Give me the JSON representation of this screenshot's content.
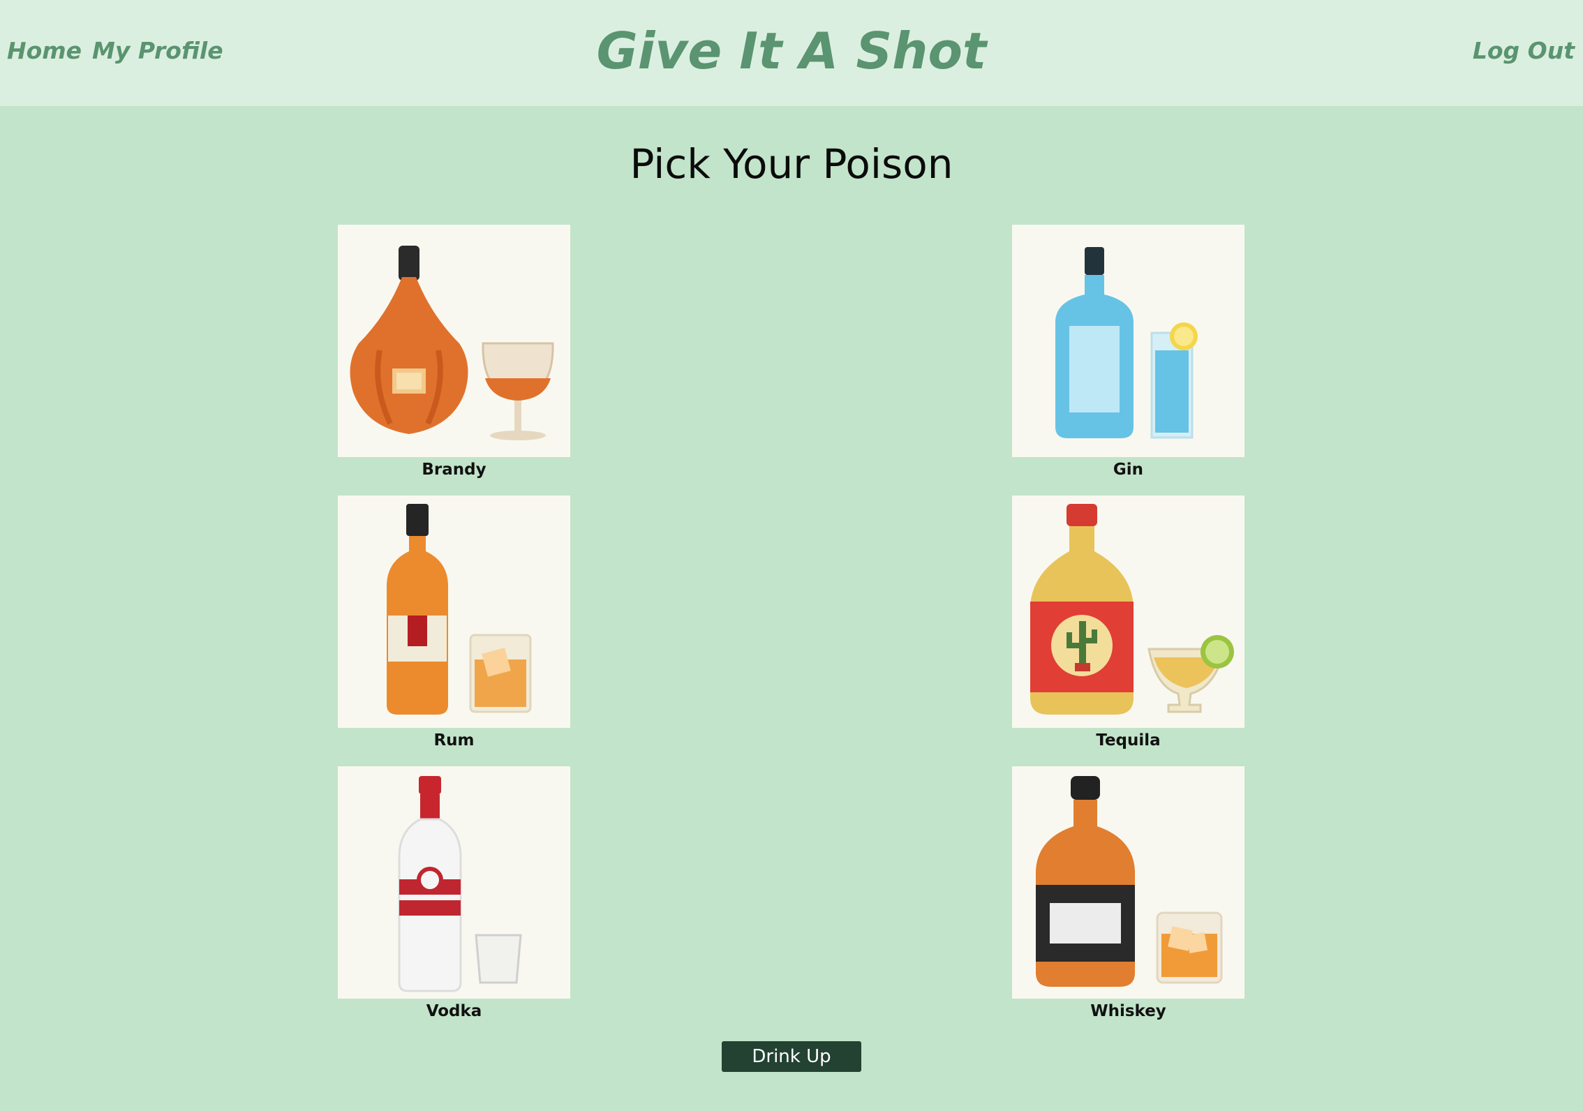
{
  "header": {
    "nav": {
      "home_label": "Home",
      "profile_label": "My Profile",
      "logout_label": "Log Out"
    },
    "brand_title": "Give It A Shot"
  },
  "main": {
    "title": "Pick Your Poison",
    "drinks": [
      {
        "label": "Brandy",
        "icon": "brandy-bottle-and-snifter"
      },
      {
        "label": "Gin",
        "icon": "gin-bottle-and-highball"
      },
      {
        "label": "Rum",
        "icon": "rum-bottle-and-rocks-glass"
      },
      {
        "label": "Tequila",
        "icon": "tequila-bottle-and-margarita-glass"
      },
      {
        "label": "Vodka",
        "icon": "vodka-bottle-and-shot-glass"
      },
      {
        "label": "Whiskey",
        "icon": "whiskey-bottle-and-rocks-glass"
      }
    ],
    "submit_label": "Drink Up"
  },
  "colors": {
    "background": "#c2e4ca",
    "header_background": "#dbefe0",
    "accent_text": "#5a9470",
    "button": "#234232",
    "card_background": "#f9f8f0"
  }
}
